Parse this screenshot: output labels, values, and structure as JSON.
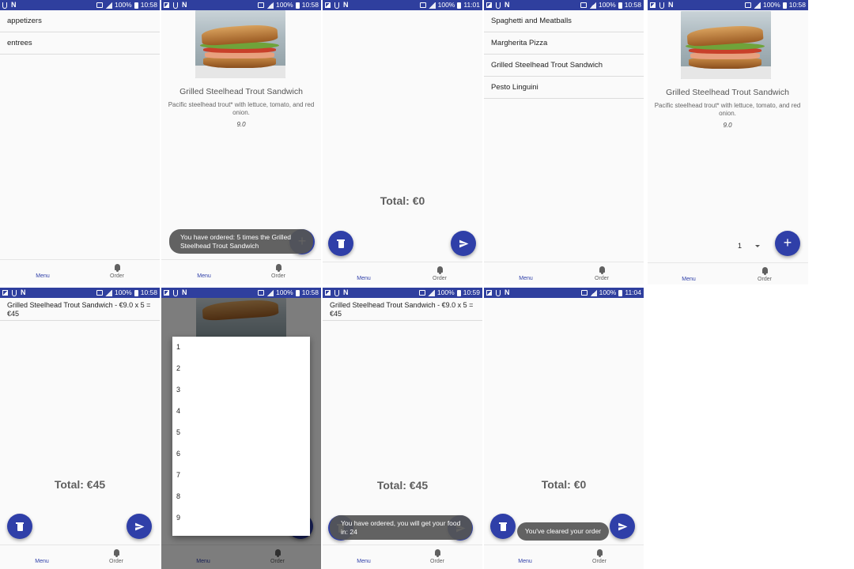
{
  "status_times": [
    "10:58",
    "10:58",
    "11:01",
    "10:58",
    "10:58",
    "10:58",
    "10:58",
    "10:59",
    "11:04"
  ],
  "battery": "100%",
  "nav": {
    "menu": "Menu",
    "order": "Order"
  },
  "categories": [
    "appetizers",
    "entrees"
  ],
  "entrees": [
    "Spaghetti and Meatballs",
    "Margherita Pizza",
    "Grilled Steelhead Trout Sandwich",
    "Pesto Linguini"
  ],
  "dish": {
    "name": "Grilled Steelhead Trout Sandwich",
    "description": "Pacific steelhead trout* with lettuce, tomato, and red onion.",
    "price": "9.0"
  },
  "quantity": "1",
  "quantity_options": [
    "1",
    "2",
    "3",
    "4",
    "5",
    "6",
    "7",
    "8",
    "9"
  ],
  "order_line": "Grilled Steelhead Trout Sandwich - €9.0 x 5 = €45",
  "totals": {
    "empty": "Total: €0",
    "full": "Total: €45"
  },
  "toasts": {
    "ordered_times": "You have ordered: 5 times the Grilled Steelhead Trout Sandwich",
    "ordered_wait": "You have ordered, you will get your food in: 24",
    "cleared": "You've cleared your order"
  },
  "colors": {
    "primary": "#2f3fa8",
    "statusbar": "#2f3f9e"
  },
  "icons": [
    "menu-grid-icon",
    "bell-icon",
    "trash-icon",
    "send-icon",
    "plus-icon",
    "dropdown-arrow-icon"
  ]
}
